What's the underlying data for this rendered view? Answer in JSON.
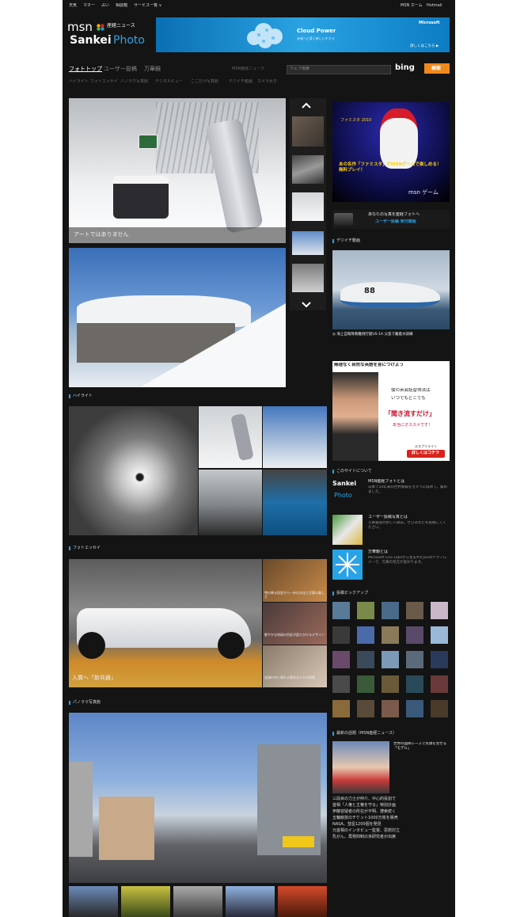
{
  "topnav": {
    "left": [
      "天気",
      "マネー",
      "占い",
      "相談箱",
      "サービス一覧 ∨"
    ],
    "right": [
      "MSN ホーム",
      "Hotmail"
    ]
  },
  "logo": {
    "msn": "msn",
    "sankei_news": "産経ニュース",
    "brand_a": "Sankei",
    "brand_b": "Photo"
  },
  "banner_ad": {
    "title": "Cloud Power",
    "sub": "未来へと導く新しいチカラ",
    "brand": "Microsoft",
    "link": "詳しくはこちら ▶"
  },
  "mainnav": {
    "tabs": [
      "フォトトップ",
      "ユーザー投稿",
      "万華鏡"
    ],
    "search_scope": "MSN産経ニュース",
    "search_placeholder": "ウェブ検索",
    "bing": "bing",
    "search_button": "検索"
  },
  "subnav": [
    "ハイライト",
    "フォトエッセイ",
    "パノラマ写真館",
    "デジタルビュー",
    "ここだけ写真館",
    "デジイチ動画",
    "カメラ女子"
  ],
  "slideshow": {
    "caption": "アートではありません"
  },
  "sections": {
    "highlight": "ハイライト",
    "essay": "フォトエッセイ",
    "panorama": "パノラマ写真館"
  },
  "essay": {
    "main_caption": "入賞へ「新兵器」",
    "side_captions": [
      "雪の降る田舎から一歩の文化と言葉の美しさ",
      "鮮やかな地球の色彩が語りかけるデザイン",
      "笑顔の中に現れる素朴な人々の表情"
    ]
  },
  "right": {
    "game_ad": {
      "title": "あの名作「ファミスタ」がMSNゲームで楽しめる！無料プレイ！",
      "year": "ファミスタ 2010",
      "brand": "msn ゲーム"
    },
    "user_post": {
      "text": "あなたの写真を産経フォトへ",
      "link": "ユーザー投稿 受付開始"
    },
    "video": {
      "heading": "デジイチ動画",
      "number": "88",
      "caption": "◎ 海上自衛隊救難飛行艇US-1A 父島で離着水訓練"
    },
    "english_ad": {
      "title": "無理なく自然な英語を身につけよう",
      "speech1": "僕の英会話習得法は",
      "speech2": "いつでもどこでも",
      "main": "「聞き流すだけ」",
      "sub": "本当にオススメです！",
      "brand": "エスプリライン",
      "button": "詳しくはコチラ"
    },
    "about": {
      "heading": "このサイトについて",
      "items": [
        {
          "title": "MSN産経フォトとは",
          "desc": "日本で10年来の世界情報をカメラに収めて、集めました。"
        },
        {
          "title": "ユーザー投稿写真とは",
          "desc": "写真報道の新しい試み。ぜひあなたも投稿してください。"
        },
        {
          "title": "万華鏡とは",
          "desc": "Microsoft Live Labsから生まれたpivotテクノロジーで、写真の見方が変わります。"
        }
      ]
    },
    "pickup": {
      "heading": "投稿ピックアップ"
    },
    "topics": {
      "heading": "最新の話題（MSN産経ニュース）",
      "lead": "世界の国際レースで笑顔を見せる「モデル」",
      "items": [
        "三段目の力士が仲介、中心的役割で",
        "首相「人権と主権を守る」特別計画",
        "伊藤容疑者の所在が不明、捜索続く",
        "五輪競技のチケット1000万枚を販売",
        "NASA、彗星1200個を発見",
        "元首相のインタビュー監督、思想対立",
        "乳がん、再発抑制の米研究者が出席"
      ]
    }
  },
  "colors": {
    "accent": "#29a3e8",
    "orange": "#f08a1c",
    "bg": "#141414"
  }
}
